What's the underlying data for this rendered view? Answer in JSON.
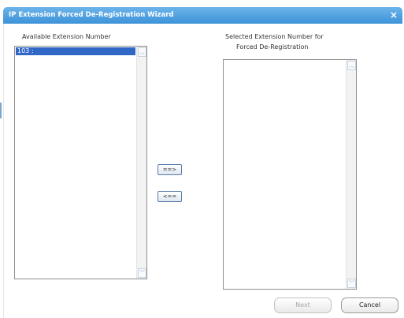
{
  "window": {
    "title": "IP Extension Forced De-Registration Wizard",
    "close_symbol": "×"
  },
  "available": {
    "header": "Available Extension Number",
    "items": [
      "103 :"
    ],
    "selected_index": 0
  },
  "selected": {
    "header_line1": "Selected Extension Number for",
    "header_line2": "Forced De-Registration",
    "items": []
  },
  "move": {
    "add_label": "==>",
    "remove_label": "<=="
  },
  "footer": {
    "next_label": "Next",
    "next_enabled": false,
    "cancel_label": "Cancel"
  },
  "icons": {
    "scroll_up": "chevron-up-icon",
    "scroll_down": "chevron-down-icon"
  },
  "colors": {
    "title_bar": "#4a9fe0",
    "selection": "#3167c6"
  }
}
